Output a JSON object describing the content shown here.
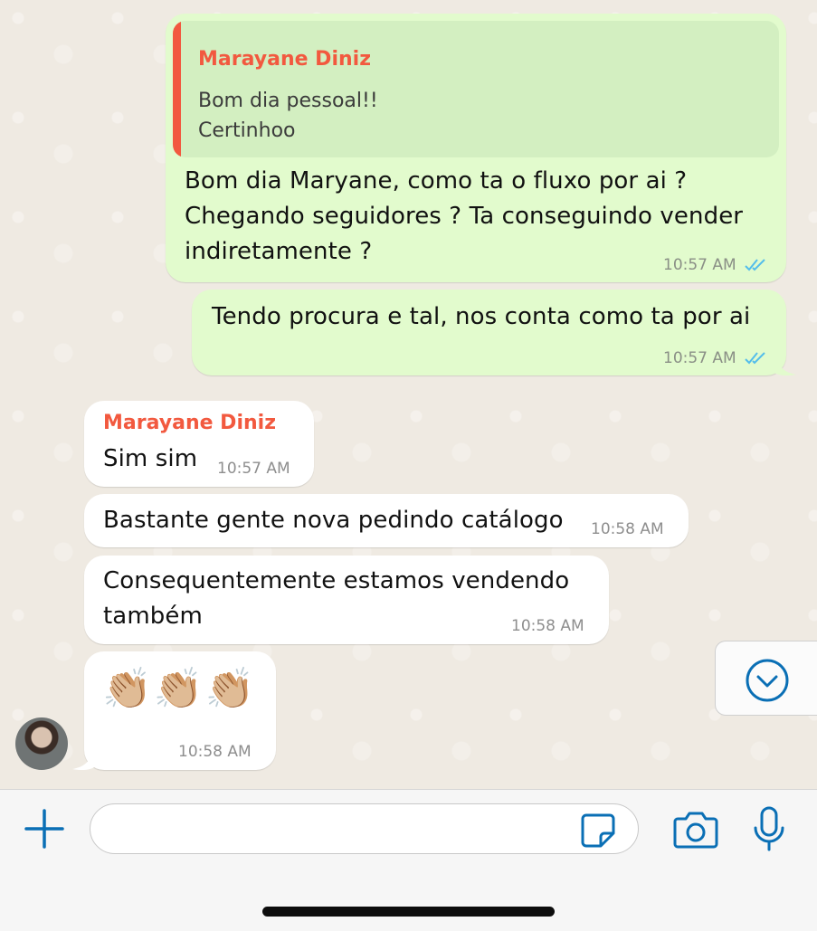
{
  "colors": {
    "outgoing_bubble": "#e2fbcd",
    "incoming_bubble": "#ffffff",
    "sender_name": "#f2593f",
    "read_ticks": "#53bdeb",
    "accent_icons": "#0a6fb5"
  },
  "messages": [
    {
      "direction": "outgoing",
      "quote": {
        "sender": "Marayane Diniz",
        "line1": "Bom dia pessoal!!",
        "line2": "Certinhoo"
      },
      "line1": "Bom dia Maryane, como ta o fluxo por ai ?",
      "line2": "Chegando seguidores ? Ta conseguindo vender",
      "line3": "indiretamente ?",
      "time": "10:57 AM",
      "status_icon": "double-check-read-icon"
    },
    {
      "direction": "outgoing",
      "line1": "Tendo procura e tal, nos conta como ta por ai",
      "time": "10:57 AM",
      "status_icon": "double-check-read-icon"
    },
    {
      "direction": "incoming",
      "sender": "Marayane Diniz",
      "line1": "Sim sim",
      "time": "10:57 AM"
    },
    {
      "direction": "incoming",
      "line1": "Bastante gente nova pedindo catálogo",
      "time": "10:58 AM"
    },
    {
      "direction": "incoming",
      "line1": "Consequentemente estamos vendendo",
      "line2": "também",
      "time": "10:58 AM"
    },
    {
      "direction": "incoming",
      "line1": "👏🏼👏🏼👏🏼",
      "time": "10:58 AM"
    }
  ],
  "scroll_button": {
    "icon": "chevron-down-circle-icon"
  },
  "composer": {
    "attach_icon": "plus-icon",
    "input_value": "",
    "sticker_icon": "sticker-icon",
    "camera_icon": "camera-icon",
    "mic_icon": "microphone-icon"
  }
}
